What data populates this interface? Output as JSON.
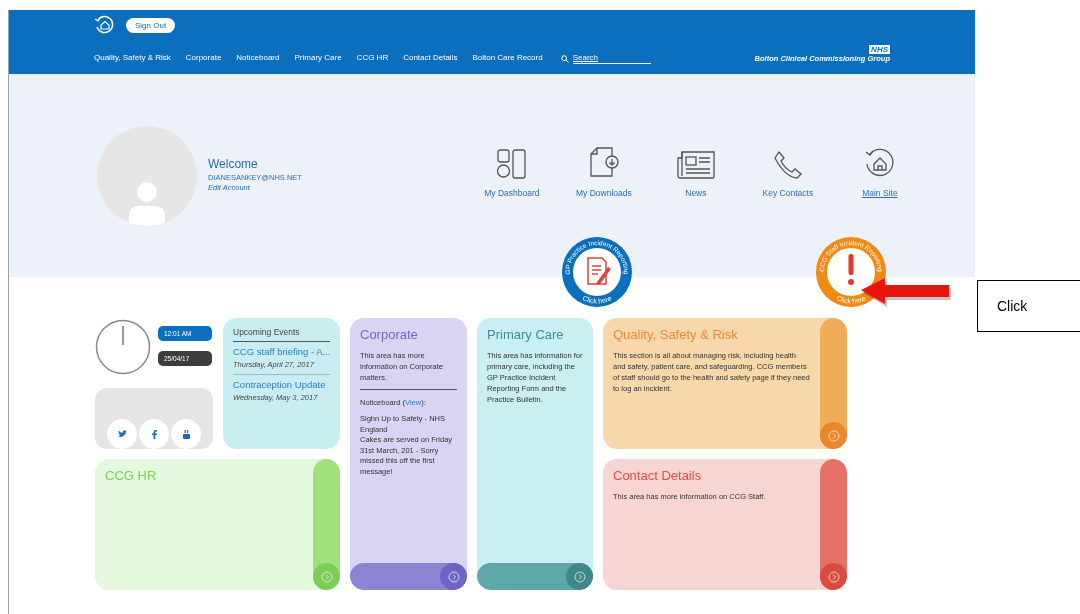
{
  "header": {
    "sign_out": "Sign Out",
    "nav": [
      "Quality, Safety & Risk",
      "Corporate",
      "Noticeboard",
      "Primary Care",
      "CCG HR",
      "Contact Details",
      "Bolton Care Record"
    ],
    "search": {
      "placeholder": "Search"
    },
    "org": {
      "badge": "NHS",
      "name": "Bolton Clinical Commissioning Group"
    }
  },
  "profile": {
    "welcome": "Welcome",
    "email": "DIANESANKEY@NHS.NET",
    "edit": "Edit Account"
  },
  "quick_links": [
    {
      "kind": "dashboard",
      "label": "My Dashboard",
      "underlined": false
    },
    {
      "kind": "downloads",
      "label": "My Downloads",
      "underlined": false
    },
    {
      "kind": "news",
      "label": "News",
      "underlined": false
    },
    {
      "kind": "contacts",
      "label": "Key Contacts",
      "underlined": false
    },
    {
      "kind": "home",
      "label": "Main Site",
      "underlined": true
    }
  ],
  "badges": [
    {
      "kind": "gp",
      "caption": "GP Practice Incident Reporting",
      "action": "Click here"
    },
    {
      "kind": "ccg",
      "caption": "CCG Staff Incident Reporting",
      "action": "Click here"
    }
  ],
  "clock": {
    "time": "12:01 AM",
    "date": "25/04/17"
  },
  "events": {
    "title": "Upcoming Events",
    "items": [
      {
        "title": "CCG staff briefing - A...",
        "date": "Thursday, April 27, 2017"
      },
      {
        "title": "Contraception Update",
        "date": "Wednesday, May 3, 2017"
      }
    ]
  },
  "tiles": [
    {
      "kind": "corporate",
      "title": "Corporate",
      "body": "This area has more information on Corporate matters.",
      "noticeboard": {
        "before": "Noticeboard (",
        "link": "View",
        "after": "):",
        "items": [
          "Sighn Up to Safety - NHS England",
          "Cakes are served on Friday 31st March, 201 - Sorry missed this off the first message!"
        ]
      }
    },
    {
      "kind": "primary",
      "title": "Primary Care",
      "body": "This area has information for primary care, including the GP Practice Incident Reporting Form and the Practice Bulletin."
    },
    {
      "kind": "qsr",
      "title": "Quality, Safety & Risk",
      "body": "This section is all about managing risk, including health and safety, patient care, and safeguarding. CCG members of staff should go to the health and safety page if they need to log an incident."
    },
    {
      "kind": "hr",
      "title": "CCG HR"
    },
    {
      "kind": "contact",
      "title": "Contact Details",
      "body": "This area has more information on CCG Staff."
    }
  ],
  "annotation": {
    "label": "Click"
  }
}
